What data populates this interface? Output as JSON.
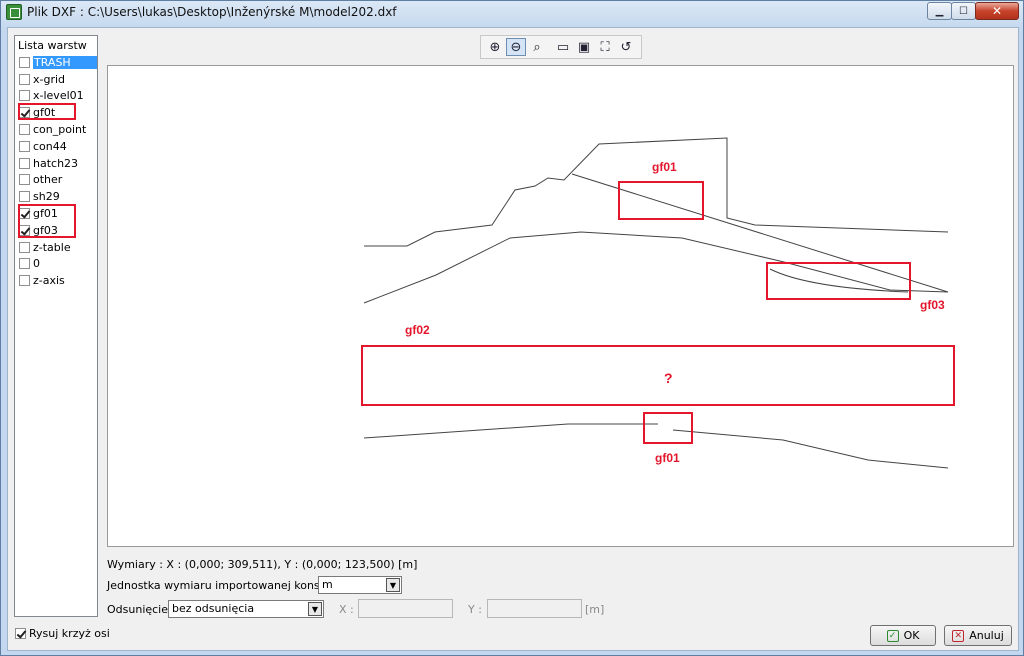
{
  "window": {
    "title": "Plik DXF : C:\\Users\\lukas\\Desktop\\Inženýrské M\\model202.dxf",
    "minimize_icon": "minimize-icon",
    "maximize_icon": "maximize-icon",
    "close_icon": "close-icon"
  },
  "layers": {
    "header": "Lista warstw",
    "items": [
      {
        "label": "TRASH",
        "checked": false,
        "selected": true
      },
      {
        "label": "x-grid",
        "checked": false
      },
      {
        "label": "x-level01",
        "checked": false
      },
      {
        "label": "gf0t",
        "checked": true
      },
      {
        "label": "con_point",
        "checked": false
      },
      {
        "label": "con44",
        "checked": false
      },
      {
        "label": "hatch23",
        "checked": false
      },
      {
        "label": "other",
        "checked": false
      },
      {
        "label": "sh29",
        "checked": false
      },
      {
        "label": "gf01",
        "checked": true
      },
      {
        "label": "gf03",
        "checked": true
      },
      {
        "label": "z-table",
        "checked": false
      },
      {
        "label": "0",
        "checked": false
      },
      {
        "label": "z-axis",
        "checked": false
      }
    ]
  },
  "toolbar": {
    "icons": [
      "zoom-in-icon",
      "zoom-out-icon",
      "zoom-window-icon",
      "zoom-extents-icon",
      "zoom-fit-icon",
      "zoom-all-icon",
      "zoom-previous-icon"
    ]
  },
  "canvas": {
    "annotations": {
      "gf01_top": "gf01",
      "gf03": "gf03",
      "gf02": "gf02",
      "question": "?",
      "gf01_bottom": "gf01"
    },
    "annotation_color": "#e3162b"
  },
  "info": {
    "dimensions": "Wymiary : X : (0,000; 309,511), Y : (0,000; 123,500) [m]"
  },
  "units": {
    "label": "Jednostka wymiaru importowanej konstrukcji :",
    "value": "m"
  },
  "offset": {
    "label": "Odsunięcie :",
    "value": "bez odsunięcia",
    "x_label": "X :",
    "y_label": "Y :",
    "unit": "[m]"
  },
  "footer": {
    "draw_axes_label": "Rysuj krzyż osi",
    "draw_axes_checked": true,
    "ok_label": "OK",
    "cancel_label": "Anuluj"
  }
}
